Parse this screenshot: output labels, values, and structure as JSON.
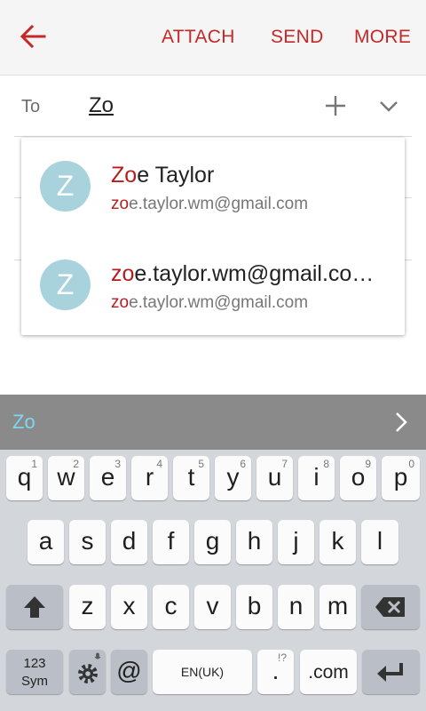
{
  "appbar": {
    "back_icon": "back-arrow-icon",
    "attach_label": "ATTACH",
    "send_label": "SEND",
    "more_label": "MORE",
    "accent": "#c62828"
  },
  "recipient": {
    "label": "To",
    "value": "Zo",
    "add_icon": "plus-icon",
    "expand_icon": "chevron-down-icon"
  },
  "suggestions": [
    {
      "avatar": "Z",
      "name_match": "Zo",
      "name_rest": "e Taylor",
      "email_match": "zo",
      "email_rest": "e.taylor.wm@gmail.com"
    },
    {
      "avatar": "Z",
      "name_match": "zo",
      "name_rest": "e.taylor.wm@gmail.co…",
      "email_match": "zo",
      "email_rest": "e.taylor.wm@gmail.com"
    }
  ],
  "predictive": {
    "word": "Zo",
    "arrow_icon": "chevron-right-icon"
  },
  "keyboard": {
    "row1": [
      {
        "ch": "q",
        "num": "1"
      },
      {
        "ch": "w",
        "num": "2"
      },
      {
        "ch": "e",
        "num": "3"
      },
      {
        "ch": "r",
        "num": "4"
      },
      {
        "ch": "t",
        "num": "5"
      },
      {
        "ch": "y",
        "num": "6"
      },
      {
        "ch": "u",
        "num": "7"
      },
      {
        "ch": "i",
        "num": "8"
      },
      {
        "ch": "o",
        "num": "9"
      },
      {
        "ch": "p",
        "num": "0"
      }
    ],
    "row2": [
      "a",
      "s",
      "d",
      "f",
      "g",
      "h",
      "j",
      "k",
      "l"
    ],
    "row3": [
      "z",
      "x",
      "c",
      "v",
      "b",
      "n",
      "m"
    ],
    "sym_top": "123",
    "sym_bottom": "Sym",
    "at": "@",
    "language": "EN(UK)",
    "period": ".",
    "period_hint": "!?",
    "dotcom": ".com",
    "shift_icon": "shift-arrow-icon",
    "backspace_icon": "backspace-icon",
    "settings_icon": "gear-icon",
    "enter_icon": "enter-icon"
  }
}
